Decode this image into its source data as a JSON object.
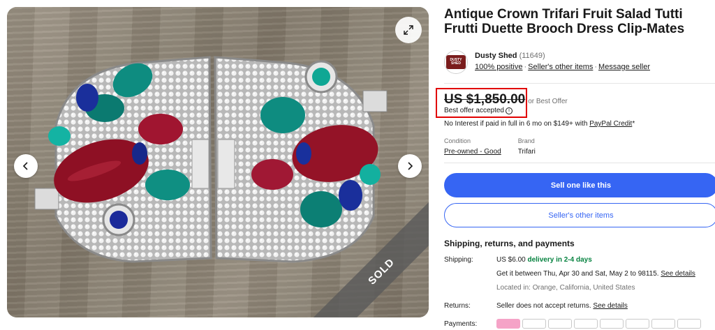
{
  "listing": {
    "title": "Antique Crown Trifari Fruit Salad Tutti Frutti Duette Brooch Dress Clip-Mates",
    "sold_label": "SOLD"
  },
  "seller": {
    "logo_text": "DUSTY SHED",
    "name": "Dusty Shed",
    "feedback_count": "(11649)",
    "positive": "100% positive",
    "other_items_link": "Seller's other items",
    "message_link": "Message seller"
  },
  "price": {
    "amount": "US $1,850.00",
    "or_best_offer": "or Best Offer",
    "best_offer_accepted": "Best offer accepted",
    "credit_text": "No Interest if paid in full in 6 mo on $149+ with ",
    "credit_link": "PayPal Credit",
    "credit_suffix": "*"
  },
  "details": {
    "condition_label": "Condition",
    "condition_value": "Pre-owned - Good",
    "brand_label": "Brand",
    "brand_value": "Trifari"
  },
  "actions": {
    "sell_one": "Sell one like this",
    "seller_other_items": "Seller's other items"
  },
  "shipping": {
    "heading": "Shipping, returns, and payments",
    "shipping_label": "Shipping:",
    "shipping_cost": "US $6.00",
    "delivery": "delivery in 2-4 days",
    "estimate_text": "Get it between Thu, Apr 30 and Sat, May 2 to 98115.",
    "see_details": "See details",
    "located": "Located in: Orange, California, United States",
    "returns_label": "Returns:",
    "returns_text": "Seller does not accept returns.",
    "returns_details": "See details",
    "payments_label": "Payments:"
  },
  "colors": {
    "accent": "#3665f3",
    "highlight_box": "#e10000",
    "delivery_green": "#05823f"
  }
}
